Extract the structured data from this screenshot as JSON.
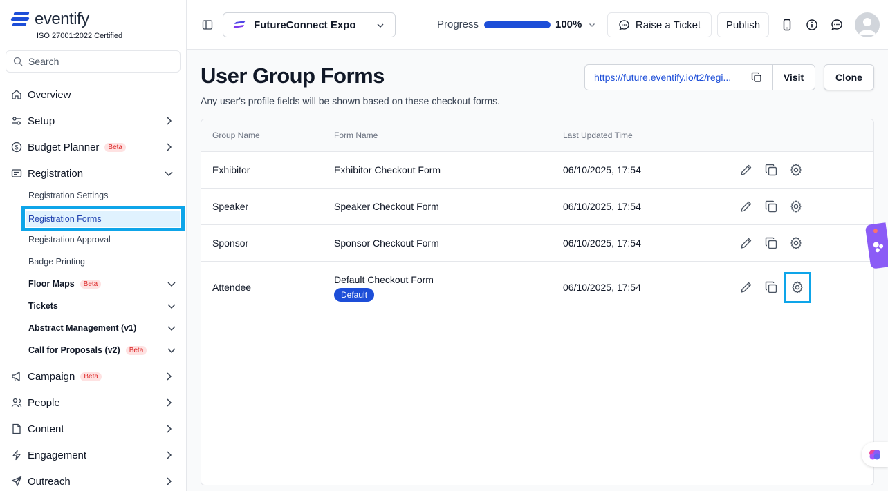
{
  "brand": {
    "name": "eventify",
    "certification": "ISO 27001:2022 Certified",
    "color": "#1d4ed8"
  },
  "search": {
    "placeholder": "Search"
  },
  "sidebar": {
    "items": [
      {
        "label": "Overview",
        "icon": "home-icon"
      },
      {
        "label": "Setup",
        "icon": "sliders-icon"
      },
      {
        "label": "Budget Planner",
        "badge": "Beta",
        "icon": "dollar-icon"
      },
      {
        "label": "Registration",
        "icon": "registration-icon"
      },
      {
        "label": "Campaign",
        "badge": "Beta",
        "icon": "megaphone-icon"
      },
      {
        "label": "People",
        "icon": "users-icon"
      },
      {
        "label": "Content",
        "icon": "document-icon"
      },
      {
        "label": "Engagement",
        "icon": "lightning-icon"
      },
      {
        "label": "Outreach",
        "icon": "send-icon"
      }
    ],
    "registration_sub": [
      {
        "label": "Registration Settings"
      },
      {
        "label": "Registration Forms"
      },
      {
        "label": "Registration Approval"
      },
      {
        "label": "Badge Printing"
      },
      {
        "label": "Floor Maps",
        "badge": "Beta"
      },
      {
        "label": "Tickets"
      },
      {
        "label": "Abstract Management (v1)"
      },
      {
        "label": "Call for Proposals (v2)",
        "badge": "Beta"
      }
    ]
  },
  "topbar": {
    "event_name": "FutureConnect Expo",
    "progress_label": "Progress",
    "progress_value": "100%",
    "progress_fraction": 1.0,
    "raise_ticket": "Raise a Ticket",
    "publish": "Publish"
  },
  "main": {
    "title": "User Group Forms",
    "subtitle": "Any user's profile fields will be shown based on these checkout forms.",
    "url": "https://future.eventify.io/t2/regi...",
    "visit": "Visit",
    "clone": "Clone",
    "columns": [
      "Group Name",
      "Form Name",
      "Last Updated Time"
    ],
    "rows": [
      {
        "group": "Exhibitor",
        "form": "Exhibitor Checkout Form",
        "updated": "06/10/2025, 17:54"
      },
      {
        "group": "Speaker",
        "form": "Speaker Checkout Form",
        "updated": "06/10/2025, 17:54"
      },
      {
        "group": "Sponsor",
        "form": "Sponsor Checkout Form",
        "updated": "06/10/2025, 17:54"
      },
      {
        "group": "Attendee",
        "form": "Default Checkout Form",
        "badge": "Default",
        "updated": "06/10/2025, 17:54"
      }
    ]
  }
}
